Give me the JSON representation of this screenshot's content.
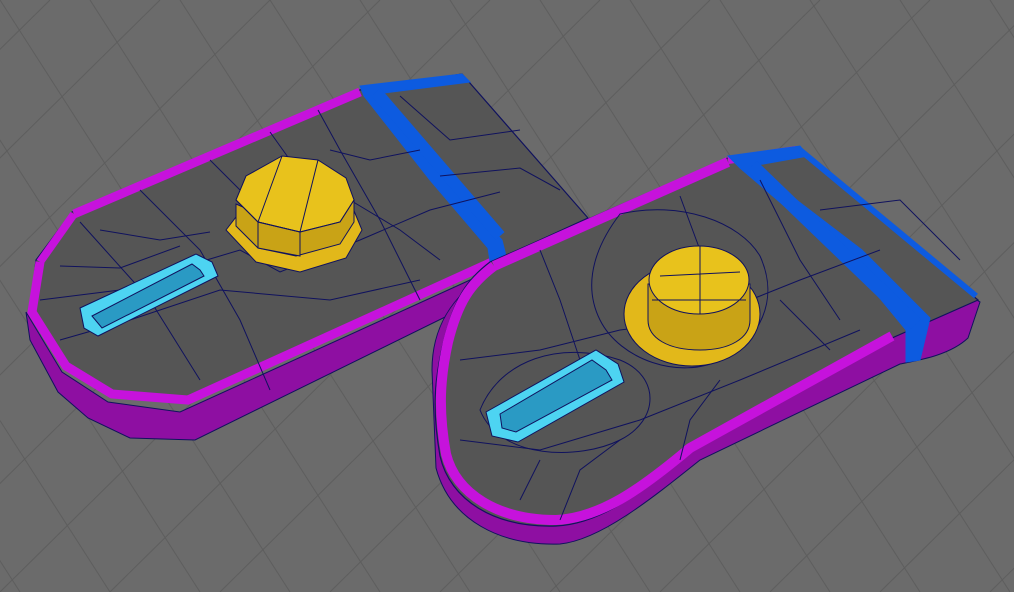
{
  "viewport": {
    "kind": "3d-modeling-viewport",
    "background_color": "#6b6b6b",
    "grid_color": "#5e5e5e"
  },
  "colors": {
    "top_face": "#555555",
    "wire": "#10125e",
    "rim": "#c612dc",
    "rim_side": "#8e0fa2",
    "band": "#0d5be0",
    "band_side": "#0a44b0",
    "boss_top": "#e8c21c",
    "boss_side": "#c9a316",
    "flange": "#e2b81a",
    "slot": "#4dd4f2",
    "slot_inner": "#2a9ac4"
  },
  "objects": [
    {
      "name": "part-left",
      "boss_shape": "octagonal-boss",
      "slot": "rectangular-slot"
    },
    {
      "name": "part-right",
      "boss_shape": "round-boss",
      "slot": "rectangular-slot"
    }
  ]
}
